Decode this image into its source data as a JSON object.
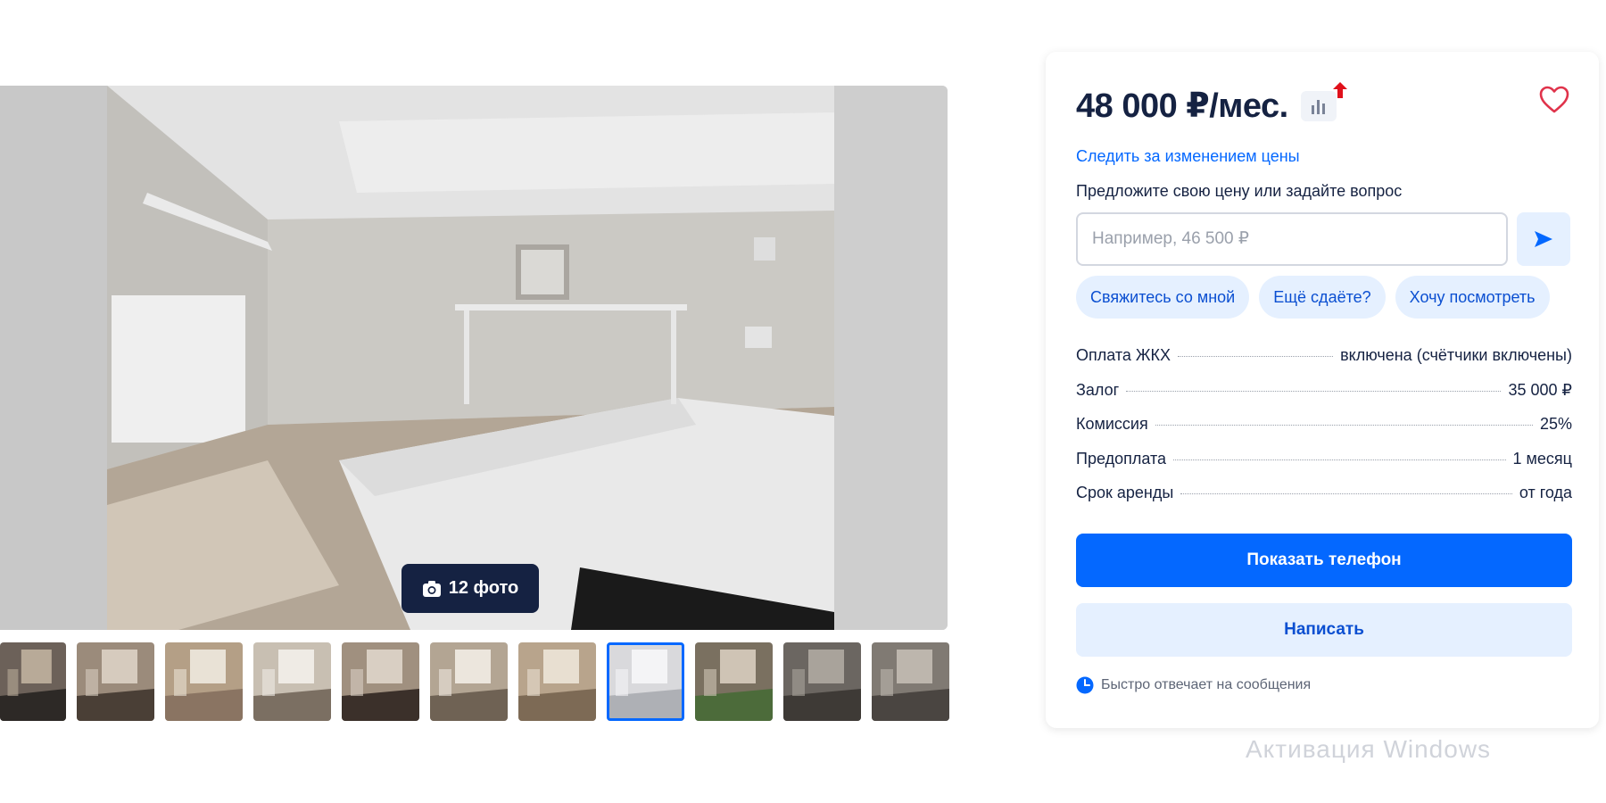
{
  "gallery": {
    "photo_count_label": "12 фото",
    "thumbnails": [
      {
        "name": "thumb-1"
      },
      {
        "name": "thumb-2"
      },
      {
        "name": "thumb-3"
      },
      {
        "name": "thumb-4"
      },
      {
        "name": "thumb-5"
      },
      {
        "name": "thumb-6"
      },
      {
        "name": "thumb-7"
      },
      {
        "name": "thumb-8",
        "active": true
      },
      {
        "name": "thumb-9"
      },
      {
        "name": "thumb-10"
      },
      {
        "name": "thumb-11"
      }
    ]
  },
  "card": {
    "price": "48 000 ₽/мес.",
    "follow_price_link": "Следить за изменением цены",
    "offer_label": "Предложите свою цену или задайте вопрос",
    "offer_placeholder": "Например, 46 500 ₽",
    "chips": [
      "Свяжитесь со мной",
      "Ещё сдаёте?",
      "Хочу посмотреть"
    ],
    "facts": [
      {
        "label": "Оплата ЖКХ",
        "value": "включена (счётчики включены)"
      },
      {
        "label": "Залог",
        "value": "35 000 ₽"
      },
      {
        "label": "Комиссия",
        "value": "25%"
      },
      {
        "label": "Предоплата",
        "value": "1 месяц"
      },
      {
        "label": "Срок аренды",
        "value": "от года"
      }
    ],
    "show_phone_label": "Показать телефон",
    "write_label": "Написать",
    "fast_reply_label": "Быстро отвечает на сообщения"
  },
  "watermark": "Активация Windows",
  "colors": {
    "accent": "#0468ff",
    "accent_light": "#e5f0ff",
    "text_dark": "#152242",
    "heart": "#e0334b"
  }
}
